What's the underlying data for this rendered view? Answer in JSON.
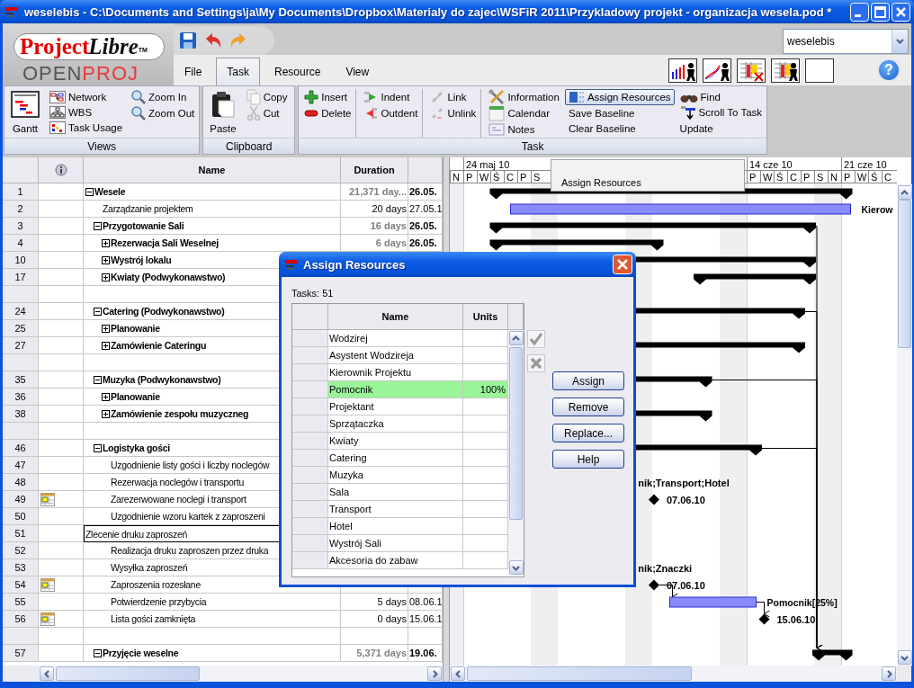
{
  "window": {
    "title": "weselebis - C:\\Documents and Settings\\ja\\My Documents\\Dropbox\\Materialy do zajec\\WSFiR 2011\\Przykladowy projekt - organizacja wesela.pod *"
  },
  "logo": {
    "wordmark": "Project",
    "wordmark_italic": "Libre",
    "trademark": "TM",
    "subtitle": "OPEN**PROJ**"
  },
  "menu_tabs": [
    {
      "label": "File",
      "selected": false
    },
    {
      "label": "Task",
      "selected": true
    },
    {
      "label": "Resource",
      "selected": false
    },
    {
      "label": "View",
      "selected": false
    }
  ],
  "project_selector": {
    "value": "weselebis"
  },
  "help_button": {
    "label": "?"
  },
  "ribbon": [
    {
      "label": "Views",
      "columns": [
        {
          "divider": false,
          "items": [
            {
              "label": "Gantt",
              "kind": "large",
              "highlighted": false
            }
          ]
        },
        {
          "divider": false,
          "items": [
            {
              "label": "Network",
              "kind": "small",
              "highlighted": false
            },
            {
              "label": "WBS",
              "kind": "small",
              "highlighted": false
            },
            {
              "label": "Task Usage",
              "kind": "small",
              "highlighted": false
            }
          ]
        },
        {
          "divider": false,
          "items": [
            {
              "label": "Zoom In",
              "kind": "small",
              "highlighted": false
            },
            {
              "label": "Zoom Out",
              "kind": "small",
              "highlighted": false
            }
          ]
        }
      ]
    },
    {
      "label": "Clipboard",
      "columns": [
        {
          "divider": false,
          "items": [
            {
              "label": "Paste",
              "kind": "large",
              "highlighted": false
            }
          ]
        },
        {
          "divider": false,
          "items": [
            {
              "label": "Copy",
              "kind": "small",
              "highlighted": false
            },
            {
              "label": "Cut",
              "kind": "small",
              "highlighted": false
            }
          ]
        }
      ]
    },
    {
      "label": "Task",
      "columns": [
        {
          "divider": true,
          "items": [
            {
              "label": "Insert",
              "kind": "small",
              "highlighted": false
            },
            {
              "label": "Delete",
              "kind": "small",
              "highlighted": false
            }
          ]
        },
        {
          "divider": true,
          "items": [
            {
              "label": "Indent",
              "kind": "small",
              "highlighted": false
            },
            {
              "label": "Outdent",
              "kind": "small",
              "highlighted": false
            }
          ]
        },
        {
          "divider": true,
          "items": [
            {
              "label": "Link",
              "kind": "small",
              "highlighted": false
            },
            {
              "label": "Unlink",
              "kind": "small",
              "highlighted": false
            }
          ]
        },
        {
          "divider": false,
          "items": [
            {
              "label": "Information",
              "kind": "small",
              "highlighted": false
            },
            {
              "label": "Calendar",
              "kind": "small",
              "highlighted": false
            },
            {
              "label": "Notes",
              "kind": "small",
              "highlighted": false
            }
          ]
        },
        {
          "divider": false,
          "items": [
            {
              "label": "Assign Resources",
              "kind": "small",
              "highlighted": true
            },
            {
              "label": "Save Baseline",
              "kind": "small",
              "highlighted": false
            },
            {
              "label": "Clear Baseline",
              "kind": "small",
              "highlighted": false
            }
          ]
        },
        {
          "divider": false,
          "items": [
            {
              "label": "Find",
              "kind": "small",
              "highlighted": false
            },
            {
              "label": "Scroll To Task",
              "kind": "small",
              "highlighted": false
            },
            {
              "label": "Update",
              "kind": "small",
              "highlighted": false
            }
          ]
        }
      ]
    }
  ],
  "task_table": {
    "columns": [
      "Name",
      "Duration"
    ],
    "rows": [
      {
        "id": "1",
        "name": "Wesele",
        "kind": "summary",
        "expanded": true,
        "indicator": false,
        "selected": false,
        "duration": "21,371 day...",
        "start": "26.05.",
        "bar": {
          "kind": "summary"
        },
        "children": [
          {
            "id": "2",
            "name": "Zarządzanie projektem",
            "kind": "task",
            "indicator": false,
            "selected": false,
            "duration": "20 days",
            "start": "27.05.1",
            "bar": {
              "kind": "task",
              "label": "Kierow"
            }
          },
          {
            "id": "3",
            "name": "Przygotowanie Sali",
            "kind": "summary",
            "expanded": true,
            "indicator": false,
            "selected": false,
            "duration": "16 days",
            "start": "26.05.",
            "bar": {
              "kind": "summary"
            },
            "children": [
              {
                "id": "4",
                "name": "Rezerwacja Sali Weselnej",
                "kind": "summary",
                "expanded": false,
                "indicator": false,
                "selected": false,
                "duration": "6 days",
                "start": "26.05.",
                "bar": {
                  "kind": "summary"
                }
              },
              {
                "id": "10",
                "name": "Wystrój lokalu",
                "kind": "summary",
                "expanded": false,
                "indicator": false,
                "selected": false,
                "bar": {
                  "kind": "summary"
                }
              },
              {
                "id": "17",
                "name": "Kwiaty (Podwykonawstwo)",
                "kind": "summary",
                "expanded": false,
                "indicator": false,
                "selected": false,
                "bar": {
                  "kind": "summary"
                }
              }
            ]
          },
          {
            "kind": "blank"
          },
          {
            "id": "24",
            "name": "Catering (Podwykonawstwo)",
            "kind": "summary",
            "expanded": true,
            "indicator": false,
            "selected": false,
            "bar": {
              "kind": "summary"
            },
            "children": [
              {
                "id": "25",
                "name": "Planowanie",
                "kind": "summary",
                "expanded": false,
                "indicator": false,
                "selected": false
              },
              {
                "id": "27",
                "name": "Zamówienie Cateringu",
                "kind": "summary",
                "expanded": false,
                "indicator": false,
                "selected": false,
                "bar": {
                  "kind": "summary"
                }
              }
            ]
          },
          {
            "kind": "blank"
          },
          {
            "id": "35",
            "name": "Muzyka (Podwykonawstwo)",
            "kind": "summary",
            "expanded": true,
            "indicator": false,
            "selected": false,
            "bar": {
              "kind": "summary"
            },
            "children": [
              {
                "id": "36",
                "name": "Planowanie",
                "kind": "summary",
                "expanded": false,
                "indicator": false,
                "selected": false
              },
              {
                "id": "38",
                "name": "Zamówienie zespołu muzyczneg",
                "kind": "summary",
                "expanded": false,
                "indicator": false,
                "selected": false,
                "bar": {
                  "kind": "summary"
                }
              }
            ]
          },
          {
            "kind": "blank"
          },
          {
            "id": "46",
            "name": "Logistyka gości",
            "kind": "summary",
            "expanded": true,
            "indicator": false,
            "selected": false,
            "bar": {
              "kind": "summary"
            },
            "children": [
              {
                "id": "47",
                "name": "Uzgodnienie listy gości i liczby noclegów",
                "kind": "task",
                "indicator": false,
                "selected": false
              },
              {
                "id": "48",
                "name": "Rezerwacja noclegów i transportu",
                "kind": "task",
                "indicator": false,
                "selected": false,
                "bar": {
                  "kind": "label",
                  "label": "nik;Transport;Hotel"
                }
              },
              {
                "id": "49",
                "name": "Zarezerwowane noclegi i transport",
                "kind": "task",
                "indicator": true,
                "selected": false,
                "bar": {
                  "kind": "milestone",
                  "label": "07.06.10"
                }
              },
              {
                "id": "50",
                "name": "Uzgodnienie wzoru kartek z zaproszeni",
                "kind": "task",
                "indicator": false,
                "selected": false
              },
              {
                "id": "51",
                "name": "Zlecenie druku zaproszeń",
                "kind": "task",
                "indicator": false,
                "selected": true
              },
              {
                "id": "52",
                "name": "Realizacja druku zaproszen przez druka",
                "kind": "task",
                "indicator": false,
                "selected": false
              },
              {
                "id": "53",
                "name": "Wysyłka zaproszeń",
                "kind": "task",
                "indicator": false,
                "selected": false,
                "bar": {
                  "kind": "label",
                  "label": "nik;Znaczki"
                }
              },
              {
                "id": "54",
                "name": "Zaproszenia rozesłane",
                "kind": "task",
                "indicator": true,
                "selected": false,
                "bar": {
                  "kind": "milestone",
                  "label": "07.06.10"
                }
              },
              {
                "id": "55",
                "name": "Potwierdzenie  przybycia",
                "kind": "task",
                "indicator": false,
                "selected": false,
                "duration": "5 days",
                "start": "08.06.1",
                "bar": {
                  "kind": "task",
                  "label": "Pomocnik[25%]"
                }
              },
              {
                "id": "56",
                "name": "Lista gości zamknięta",
                "kind": "task",
                "indicator": true,
                "selected": false,
                "duration": "0 days",
                "start": "15.06.1",
                "bar": {
                  "kind": "milestone",
                  "label": "15.06.10"
                }
              }
            ]
          },
          {
            "kind": "blank"
          },
          {
            "id": "57",
            "name": "Przyjęcie weselne",
            "kind": "summary",
            "expanded": true,
            "indicator": false,
            "selected": false,
            "duration": "5,371 days",
            "start": "19.06.",
            "bar": {
              "kind": "summary"
            }
          }
        ]
      }
    ]
  },
  "gantt": {
    "timescale": {
      "leading_days": [
        "N"
      ],
      "weeks": [
        {
          "label": "24 maj 10",
          "days": [
            "P",
            "W",
            "Ś",
            "C",
            "P",
            "S"
          ]
        },
        {
          "label": "14 cze 10",
          "days": [
            "P",
            "W",
            "Ś",
            "C",
            "P",
            "S",
            "N"
          ]
        },
        {
          "label": "21 cze 10",
          "days": [
            "P",
            "W",
            "Ś",
            "C"
          ]
        }
      ]
    },
    "tooltip": "Assign Resources"
  },
  "assign_dialog": {
    "title": "Assign Resources",
    "tasks_label": "Tasks: 51",
    "columns": [
      "Name",
      "Units"
    ],
    "resources": [
      {
        "name": "Wodzirej",
        "assigned": false
      },
      {
        "name": "Asystent Wodzireja",
        "assigned": false
      },
      {
        "name": "Kierownik Projektu",
        "assigned": false
      },
      {
        "name": "Pomocnik",
        "assigned": true,
        "units": "100%"
      },
      {
        "name": "Projektant",
        "assigned": false
      },
      {
        "name": "Sprzątaczka",
        "assigned": false
      },
      {
        "name": "Kwiaty",
        "assigned": false
      },
      {
        "name": "Catering",
        "assigned": false
      },
      {
        "name": "Muzyka",
        "assigned": false
      },
      {
        "name": "Sala",
        "assigned": false
      },
      {
        "name": "Transport",
        "assigned": false
      },
      {
        "name": "Hotel",
        "assigned": false
      },
      {
        "name": "Wystrój Sali",
        "assigned": false
      },
      {
        "name": "Akcesoria do zabaw",
        "assigned": false
      }
    ],
    "buttons": [
      "Assign",
      "Remove",
      "Replace...",
      "Help"
    ]
  }
}
